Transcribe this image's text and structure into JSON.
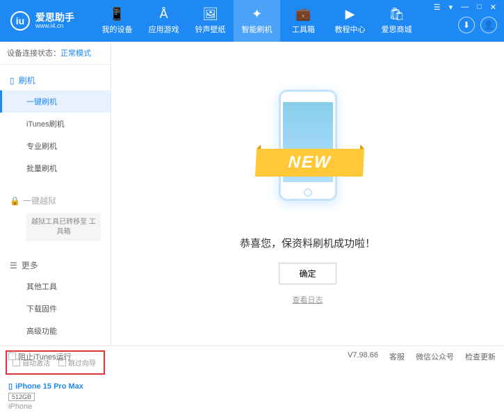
{
  "header": {
    "logo_letter": "iu",
    "title": "爱思助手",
    "url": "www.i4.cn",
    "tabs": [
      {
        "label": "我的设备",
        "icon": "📱"
      },
      {
        "label": "应用游戏",
        "icon": "Å"
      },
      {
        "label": "铃声壁纸",
        "icon": "🖼"
      },
      {
        "label": "智能刷机",
        "icon": "✦"
      },
      {
        "label": "工具箱",
        "icon": "💼"
      },
      {
        "label": "教程中心",
        "icon": "▶"
      },
      {
        "label": "爱思商城",
        "icon": "🛍"
      }
    ],
    "window_controls": {
      "menu": "☰",
      "tray": "▾",
      "min": "—",
      "max": "□",
      "close": "✕"
    },
    "download_icon": "⬇",
    "user_icon": "👤"
  },
  "sidebar": {
    "status_label": "设备连接状态：",
    "status_mode": "正常模式",
    "sections": {
      "flash": {
        "header": "刷机",
        "items": [
          "一键刷机",
          "iTunes刷机",
          "专业刷机",
          "批量刷机"
        ]
      },
      "jailbreak": {
        "header": "一键越狱",
        "note": "越狱工具已转移至\n工具箱"
      },
      "more": {
        "header": "更多",
        "items": [
          "其他工具",
          "下载固件",
          "高级功能"
        ]
      }
    },
    "checkboxes": {
      "auto_activate": "自动激活",
      "skip_guide": "跳过向导"
    },
    "device": {
      "name": "iPhone 15 Pro Max",
      "storage": "512GB",
      "type": "iPhone"
    }
  },
  "main": {
    "new_label": "NEW",
    "success_text": "恭喜您，保资料刷机成功啦！",
    "ok_button": "确定",
    "log_link": "查看日志"
  },
  "footer": {
    "block_itunes": "阻止iTunes运行",
    "version": "V7.98.66",
    "links": [
      "客服",
      "微信公众号",
      "检查更新"
    ]
  }
}
